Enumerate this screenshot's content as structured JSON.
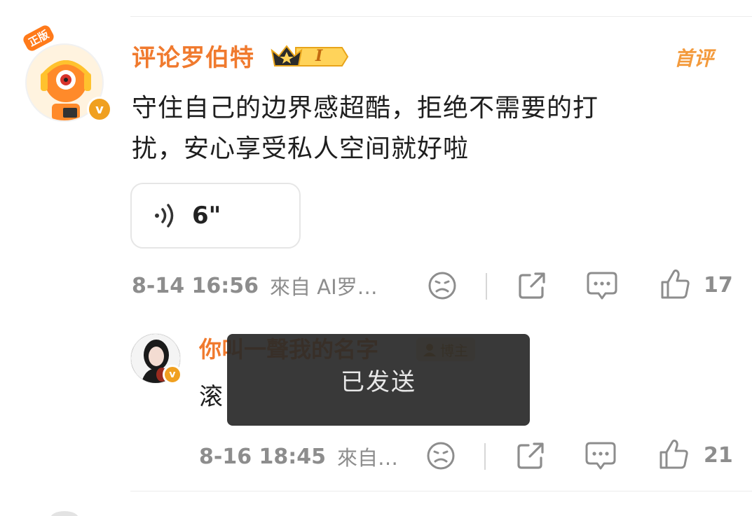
{
  "main_comment": {
    "username": "评论罗伯特",
    "avatar_tag": "正版",
    "verified_mark": "v",
    "level": "I",
    "first_label": "首评",
    "text_line1": "守住自己的边界感超酷，拒绝不需要的打",
    "text_line2": "扰，安心享受私人空间就好啦",
    "voice_duration": "6\"",
    "time": "8-14 16:56",
    "source": "來自 AI罗…",
    "like_count": "17"
  },
  "reply": {
    "username": "你叫一聲我的名字",
    "verified_mark": "v",
    "blogger_tag": "博主",
    "text": "滚",
    "time": "8-16 18:45",
    "source": "來自…",
    "like_count": "21"
  },
  "toast": {
    "message": "已发送"
  },
  "icons": [
    "sad-face-icon",
    "share-icon",
    "comment-icon",
    "thumbs-up-icon",
    "voice-wave-icon",
    "crown-icon"
  ],
  "colors": {
    "username": "#f07a2e",
    "badge": "#f0a020",
    "meta": "#8d8d8d",
    "toast_bg": "#282828"
  }
}
